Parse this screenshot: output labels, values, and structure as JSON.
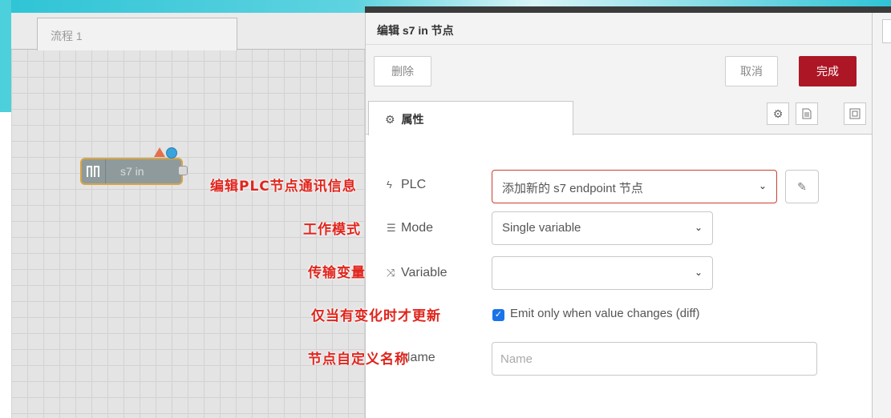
{
  "workspace": {
    "tab_label": "流程 1",
    "node_label": "s7 in"
  },
  "editor": {
    "title": "编辑 s7 in 节点",
    "delete_label": "删除",
    "cancel_label": "取消",
    "done_label": "完成",
    "properties_tab_label": "属性",
    "fields": {
      "plc": {
        "label": "PLC",
        "icon": "bolt-icon",
        "value": "添加新的 s7 endpoint 节点"
      },
      "mode": {
        "label": "Mode",
        "icon": "sliders-icon",
        "value": "Single variable"
      },
      "variable": {
        "label": "Variable",
        "icon": "shuffle-icon",
        "value": ""
      },
      "diff": {
        "label": "Emit only when value changes (diff)",
        "checked": true
      },
      "name": {
        "label": "Name",
        "icon": "tag-icon",
        "placeholder": "Name"
      }
    }
  },
  "annotations": {
    "plc": "编辑PLC节点通讯信息",
    "mode": "工作模式",
    "variable": "传输变量",
    "diff": "仅当有变化时才更新",
    "name": "节点自定义名称"
  },
  "colors": {
    "primary_button": "#ad1625",
    "annotation": "#e0241c",
    "node_border": "#d8a548",
    "status_dot": "#3aa3dd"
  }
}
